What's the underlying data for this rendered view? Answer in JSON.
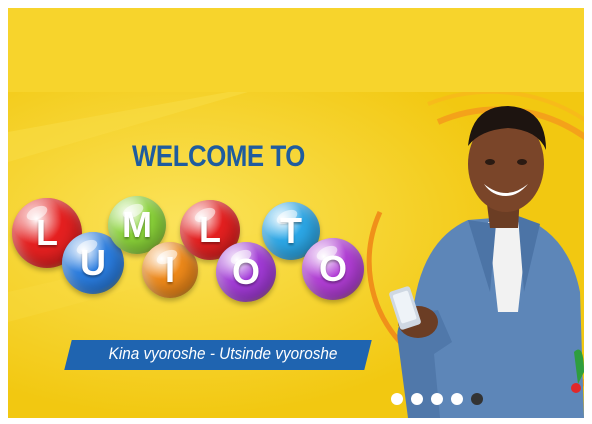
{
  "banner": {
    "welcome": "WELCOME TO",
    "logo_letters": [
      {
        "char": "L",
        "color": "#e52020"
      },
      {
        "char": "U",
        "color": "#2a7de0"
      },
      {
        "char": "M",
        "color": "#8cd63a"
      },
      {
        "char": "I",
        "color": "#f08a1a"
      },
      {
        "char": "L",
        "color": "#e52020"
      },
      {
        "char": "O",
        "color": "#a33bd8"
      },
      {
        "char": "T",
        "color": "#2ca8e8"
      },
      {
        "char": "O",
        "color": "#b23ed6"
      }
    ],
    "tagline": "Kina vyoroshe  - Utsinde vyoroshe"
  },
  "carousel": {
    "slide_count": 5,
    "active_index": 4
  },
  "colors": {
    "top_band": "#f7d42c",
    "banner_bg": "#f6d21d",
    "welcome_text": "#1f5c9e",
    "tagline_bg": "#1f64b0"
  }
}
